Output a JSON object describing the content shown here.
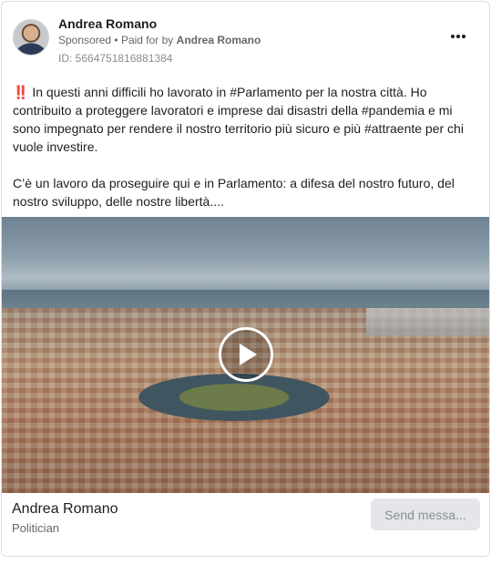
{
  "header": {
    "author": "Andrea Romano",
    "sponsored_label": "Sponsored",
    "separator": "•",
    "paid_for_prefix": "Paid for by",
    "paid_for_name": "Andrea Romano",
    "ad_id": "ID: 5664751816881384"
  },
  "post": {
    "paragraph1": "‼️ In questi anni difficili ho lavorato in #Parlamento per la nostra città. Ho contribuito a proteggere lavoratori e imprese dai disastri della #pandemia e mi sono impegnato per rendere il nostro territorio più sicuro e più #attraente per chi vuole investire.",
    "paragraph2": "C’è un lavoro da proseguire qui e in Parlamento: a difesa del nostro futuro, del nostro sviluppo, delle nostre libertà...."
  },
  "footer": {
    "page_name": "Andrea Romano",
    "page_category": "Politician",
    "cta_label": "Send messa..."
  },
  "icons": {
    "more": "more-horizontal-icon",
    "play": "play-icon"
  },
  "colors": {
    "secondary_text": "#65676b",
    "cta_background": "#e4e6eb"
  }
}
